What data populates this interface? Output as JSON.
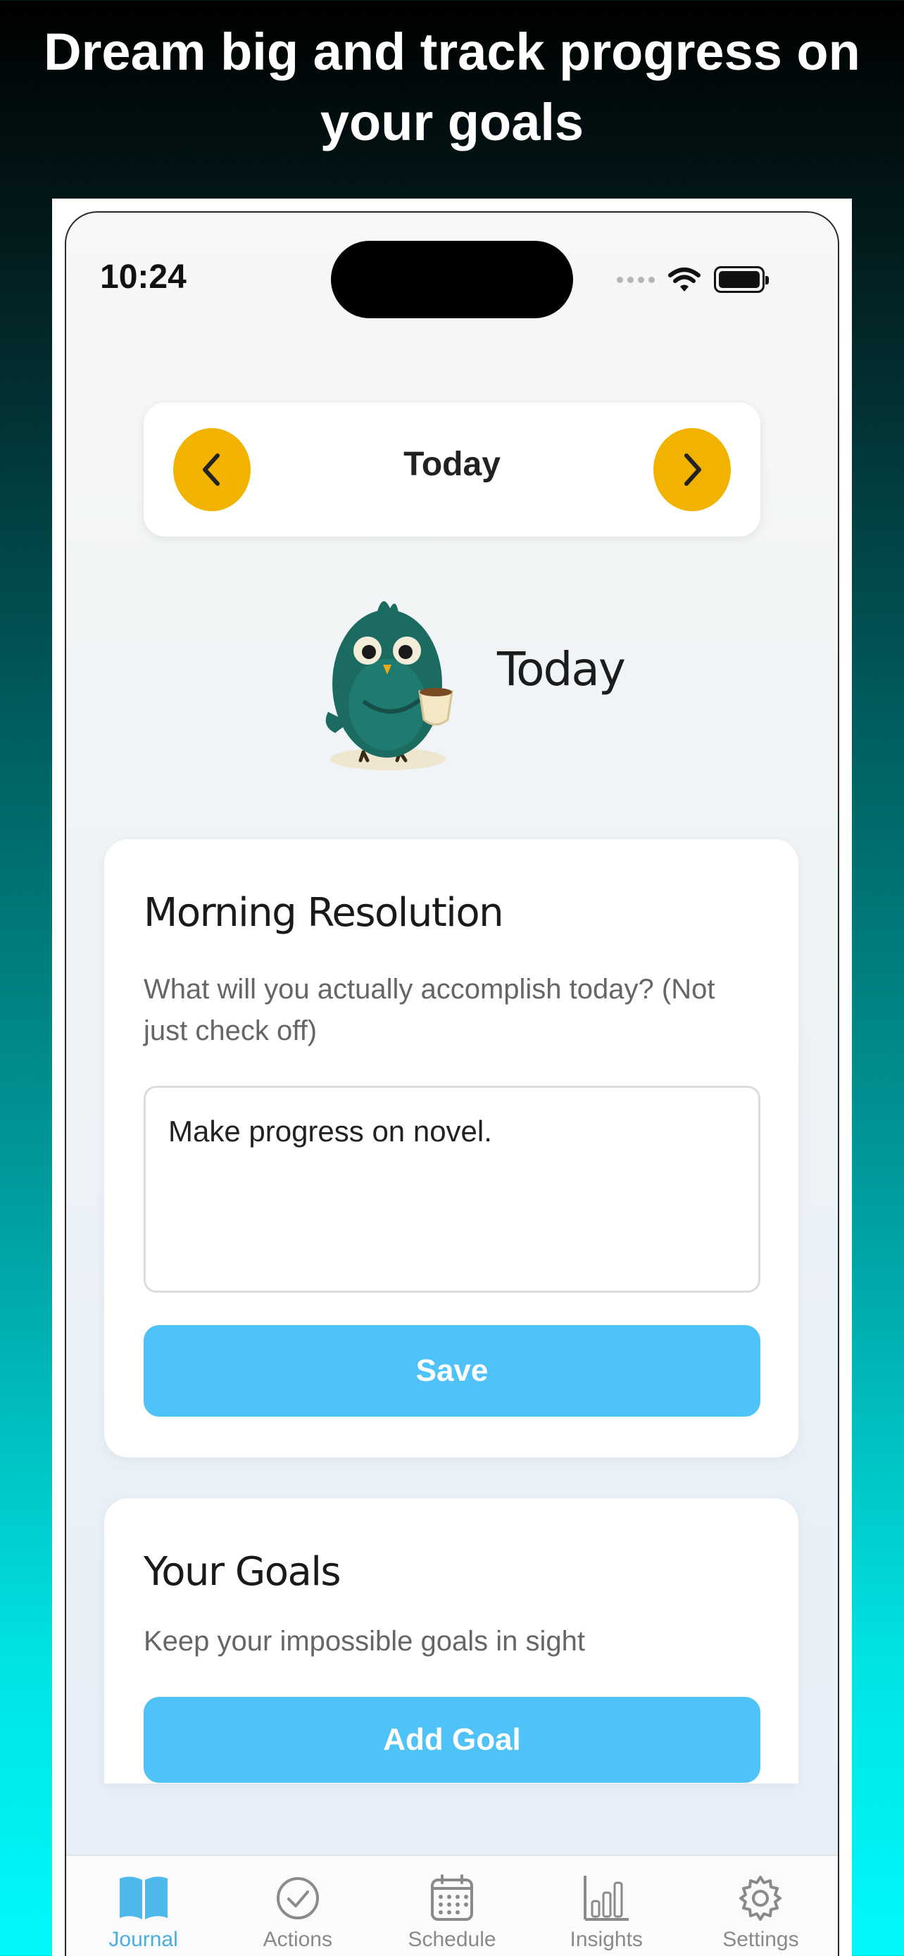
{
  "headline": "Dream big and track progress on your goals",
  "status_bar": {
    "time": "10:24",
    "icons": [
      "signal-icon",
      "wifi-icon",
      "battery-icon"
    ]
  },
  "date_nav": {
    "label": "Today",
    "prev_icon": "chevron-left-icon",
    "next_icon": "chevron-right-icon"
  },
  "mascot": {
    "title": "Today",
    "icon": "bird-mascot-icon"
  },
  "resolution_card": {
    "title": "Morning Resolution",
    "subtitle": "What will you actually accomplish today? (Not just check off)",
    "input_value": "Make progress on novel.",
    "save_label": "Save"
  },
  "goals_card": {
    "title": "Your Goals",
    "subtitle": "Keep your impossible goals in sight",
    "add_label": "Add Goal"
  },
  "tabs": [
    {
      "label": "Journal",
      "icon": "book-icon",
      "active": true
    },
    {
      "label": "Actions",
      "icon": "check-circle-icon",
      "active": false
    },
    {
      "label": "Schedule",
      "icon": "calendar-icon",
      "active": false
    },
    {
      "label": "Insights",
      "icon": "bar-chart-icon",
      "active": false
    },
    {
      "label": "Settings",
      "icon": "gear-icon",
      "active": false
    }
  ],
  "colors": {
    "accent_yellow": "#f2b200",
    "button_blue": "#4fc3f7",
    "tab_active": "#4aaee0",
    "mascot_green": "#1b6b61"
  }
}
